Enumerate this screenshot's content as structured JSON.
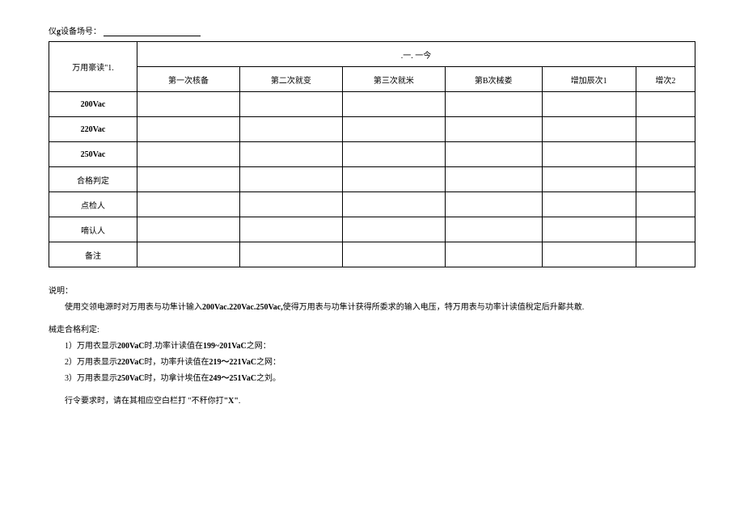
{
  "header": {
    "prefix": "仪",
    "bold_char": "g",
    "suffix": "设备场号："
  },
  "table": {
    "corner": "万用豪读\"1.",
    "top_header": ".一. 一今",
    "columns": [
      "第一次核备",
      "第二次就变",
      "第三次就米",
      "第B次械娄",
      "增加辰次1",
      "增次2"
    ],
    "rows": [
      "200Vac",
      "220Vac",
      "250Vac",
      "合格判定",
      "点检人",
      "嘀认人",
      "备注"
    ]
  },
  "section1": {
    "title": "说明：",
    "body_prefix": "使用交领电源时对万用表与功隼计输入",
    "body_bold": "200Vac.220Vac.250Vac,",
    "body_suffix": "使得万用表与功隼计获得所委求的输入电压，特万用表与功率计读值稅定后升鄙共敢."
  },
  "section2": {
    "title": "械走合格利定:",
    "item1_prefix": "1）万用衣显示",
    "item1_bold": "200VaC",
    "item1_mid": "时.功率计读值在",
    "item1_bold2": "199~201VaC",
    "item1_suffix": "之网：",
    "item2_prefix": "2）万用表显示",
    "item2_bold": "220VaC",
    "item2_mid": "时，功率升读值在",
    "item2_bold2": "219～221VaC",
    "item2_suffix": "之网：",
    "item3_prefix": "3）万用表显示",
    "item3_bold": "250VaC",
    "item3_mid": "时，功拿计埃伍在",
    "item3_bold2": "249～251VaC",
    "item3_suffix": "之刘。"
  },
  "section3": {
    "prefix": "行令要求时，请在其相应空白栏打 \"不秆你打",
    "bold": "\"X\"",
    "suffix": "."
  }
}
